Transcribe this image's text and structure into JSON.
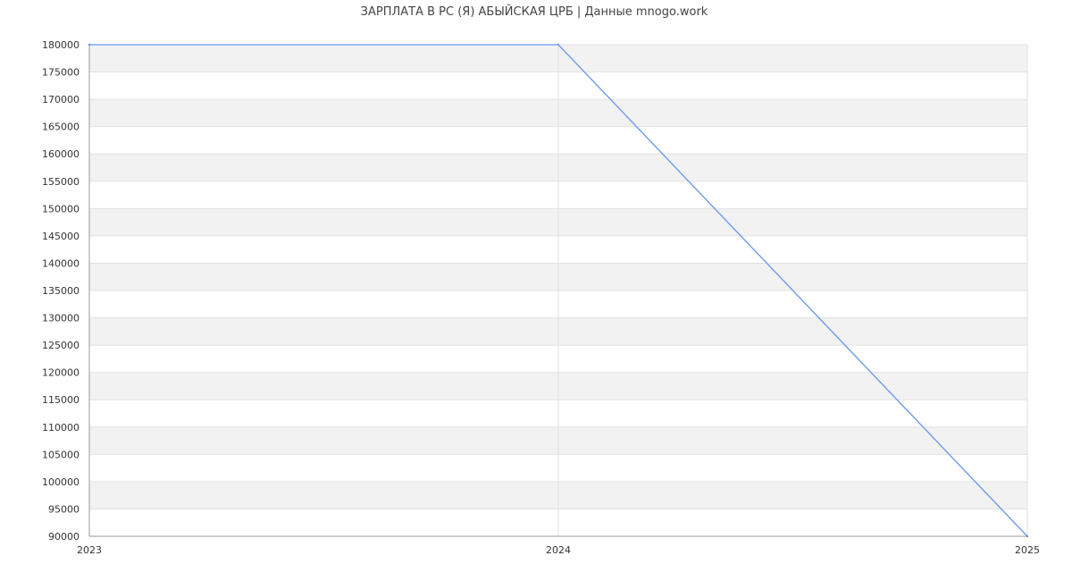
{
  "chart_data": {
    "type": "line",
    "title": "ЗАРПЛАТА В РС (Я) АБЫЙСКАЯ ЦРБ | Данные mnogo.work",
    "xlabel": "",
    "ylabel": "",
    "x": [
      "2023",
      "2024",
      "2025"
    ],
    "series": [
      {
        "values": [
          180000,
          180000,
          90000
        ]
      }
    ],
    "ylim": [
      90000,
      180000
    ],
    "ytick_step": 5000,
    "yticks": [
      "90000",
      "95000",
      "100000",
      "105000",
      "110000",
      "115000",
      "120000",
      "125000",
      "130000",
      "135000",
      "140000",
      "145000",
      "150000",
      "155000",
      "160000",
      "165000",
      "170000",
      "175000",
      "180000"
    ],
    "grid": true,
    "band_colors": [
      "#f2f2f2",
      "#ffffff"
    ],
    "line_color": "#6495ed",
    "axis_color": "#999999",
    "legend": "none"
  }
}
